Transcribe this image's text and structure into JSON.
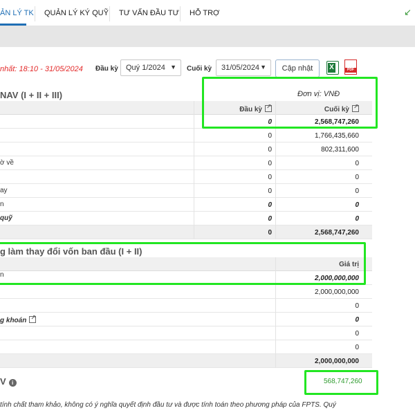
{
  "nav": {
    "tabs": [
      {
        "label": "ẢN LÝ TK"
      },
      {
        "label": "QUẢN LÝ KÝ QUỸ"
      },
      {
        "label": "TƯ VẤN ĐẦU TƯ"
      },
      {
        "label": "HỖ TRỢ"
      }
    ]
  },
  "filters": {
    "updated_text": "nhất: 18:10 - 31/05/2024",
    "start_label": "Đầu kỳ",
    "start_value": "Quý 1/2024",
    "end_label": "Cuối kỳ",
    "end_value": "31/05/2024",
    "update_button": "Cập nhật"
  },
  "section1": {
    "title": "NAV (I + II + III)",
    "unit": "Đơn vị: VNĐ",
    "col_start": "Đầu kỳ",
    "col_end": "Cuối kỳ",
    "rows": [
      {
        "label": "",
        "start": "0",
        "end": "2,568,747,260"
      },
      {
        "label": "",
        "start": "0",
        "end": "1,766,435,660"
      },
      {
        "label": "",
        "start": "0",
        "end": "802,311,600"
      },
      {
        "label": "ờ về",
        "start": "0",
        "end": "0"
      },
      {
        "label": "",
        "start": "0",
        "end": "0"
      },
      {
        "label": "ay",
        "start": "0",
        "end": "0"
      },
      {
        "label": "n",
        "start": "0",
        "end": "0"
      },
      {
        "label": "quỹ",
        "start": "0",
        "end": "0"
      },
      {
        "label": "",
        "start": "0",
        "end": "2,568,747,260"
      }
    ]
  },
  "section2": {
    "title": "g làm thay đổi vốn ban đầu (I + II)",
    "col_value": "Giá trị",
    "rows": [
      {
        "label": "n",
        "value": "2,000,000,000"
      },
      {
        "label": "",
        "value": "2,000,000,000"
      },
      {
        "label": "",
        "value": "0"
      },
      {
        "label": "g khoán",
        "value": "0"
      },
      {
        "label": "",
        "value": "0"
      },
      {
        "label": "",
        "value": "0"
      },
      {
        "label": "",
        "value": "2,000,000,000"
      }
    ]
  },
  "summary": {
    "label": "V",
    "value": "568,747,260"
  },
  "disclaimer": "tính chất tham khảo, không có ý nghĩa quyết định đầu tư và được tính toán theo phương pháp của FPTS. Quý",
  "colors": {
    "accent": "#1f6fb5",
    "highlight": "#22e622",
    "updated_text": "#e32b2b",
    "positive_value": "#2f9b2f"
  }
}
